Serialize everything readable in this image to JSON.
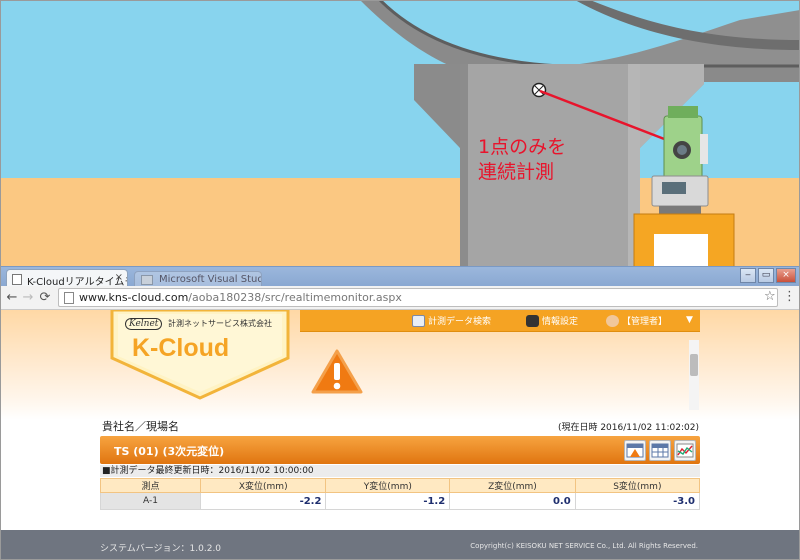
{
  "illustration": {
    "annotation_line1": "1点のみを",
    "annotation_line2": "連続計測",
    "colors": {
      "sky": "#88d4ee",
      "ground": "#fbc882",
      "measure_line": "#e8142c"
    }
  },
  "browser": {
    "tabs": [
      {
        "title": "K-Cloudリアルタイムモ",
        "close": "×"
      },
      {
        "title": "Microsoft Visual Studio"
      }
    ],
    "window_buttons": [
      "‒",
      "▭",
      "×"
    ],
    "nav": {
      "back": "←",
      "forward": "→",
      "reload": "⟳"
    },
    "url_host": "www.kns-cloud.com",
    "url_path": "/aoba180238/src/realtimemonitor.aspx",
    "bookmark": "☆",
    "menu": "⋮"
  },
  "header": {
    "brand_small": "Kelnet",
    "company": "計測ネットサービス株式会社",
    "logo_text": "K-Cloud",
    "nav_items": [
      {
        "label": "計測データ検索",
        "icon": "search-table-icon"
      },
      {
        "label": "情報設定",
        "icon": "settings-icon"
      },
      {
        "label": "【管理者】",
        "icon": "user-icon"
      }
    ],
    "dropdown": "▼"
  },
  "main": {
    "site_name": "貴社名／現場名",
    "current_time": "(現在日時 2016/11/02 11:02:02)",
    "panel_title": "TS (01) (3次元変位)",
    "last_update": "■計測データ最終更新日時：2016/11/02 10:00:00",
    "table": {
      "columns": [
        "測点",
        "X変位(mm)",
        "Y変位(mm)",
        "Z変位(mm)",
        "S変位(mm)"
      ],
      "rows": [
        {
          "point": "A-1",
          "x": "-2.2",
          "y": "-1.2",
          "z": "0.0",
          "s": "-3.0"
        }
      ]
    }
  },
  "footer": {
    "version": "システムバージョン：1.0.2.0",
    "copyright": "Copyright(c) KEISOKU NET SERVICE Co., Ltd. All Rights Reserved."
  }
}
